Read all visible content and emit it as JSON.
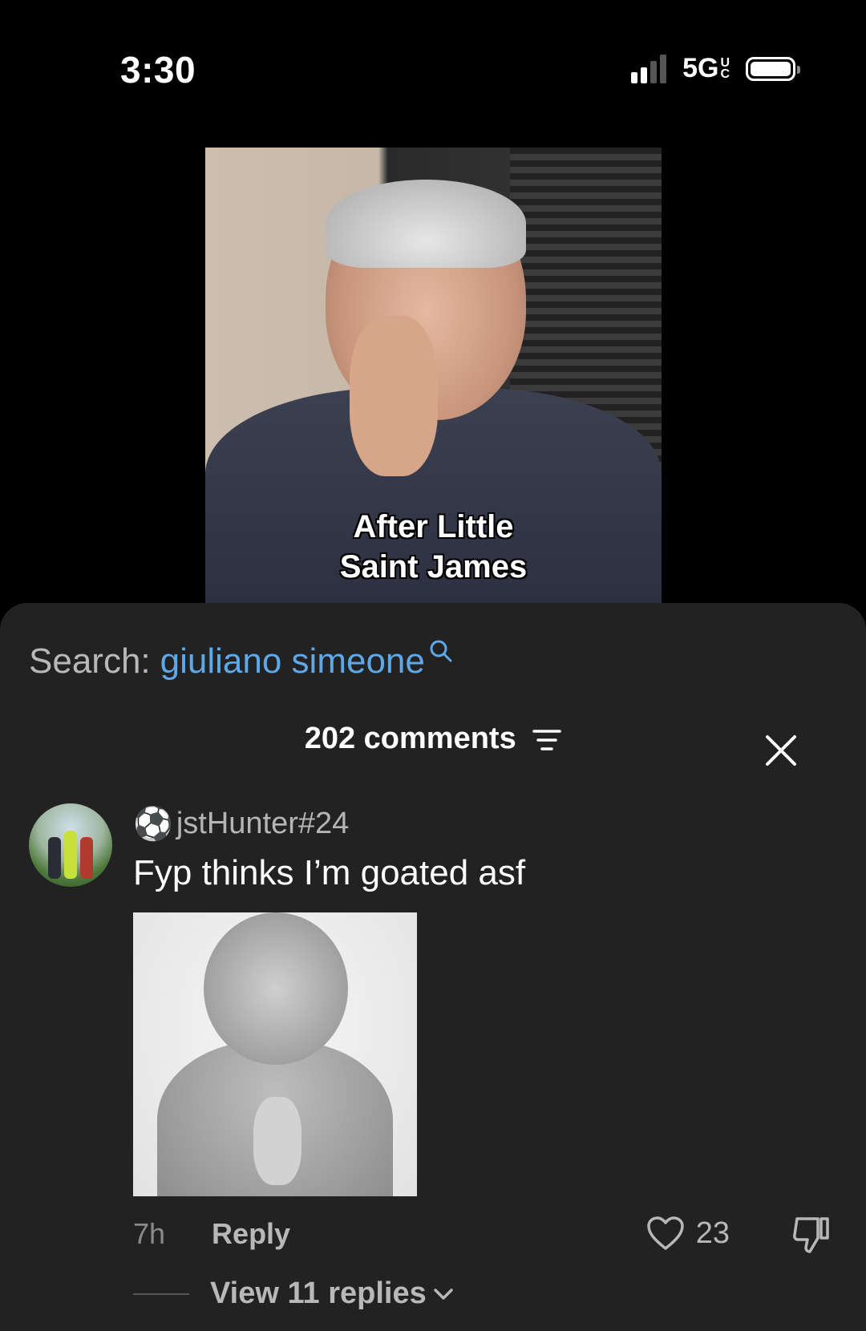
{
  "status_bar": {
    "time": "3:30",
    "network": "5G",
    "network_suffix_top": "U",
    "network_suffix_bottom": "C",
    "signal_bars_active": 2,
    "signal_bars_total": 4
  },
  "video": {
    "caption_line1": "After Little",
    "caption_line2": "Saint James"
  },
  "comments_sheet": {
    "search_prefix": "Search:",
    "search_term": "giuliano simeone",
    "comment_count_label": "202 comments",
    "comments": [
      {
        "username": "jstHunter#24",
        "username_emoji": "⚽",
        "text": "Fyp thinks I’m goated asf",
        "time": "7h",
        "reply_label": "Reply",
        "likes": "23",
        "view_replies_label": "View 11 replies"
      }
    ]
  },
  "colors": {
    "sheet_bg": "#222222",
    "search_term": "#5fa8e8",
    "muted_text": "#b8b8b8"
  },
  "icons": [
    "search-icon",
    "sort-icon",
    "close-icon",
    "heart-icon",
    "dislike-icon",
    "chevron-down-icon",
    "battery-icon",
    "signal-icon"
  ]
}
